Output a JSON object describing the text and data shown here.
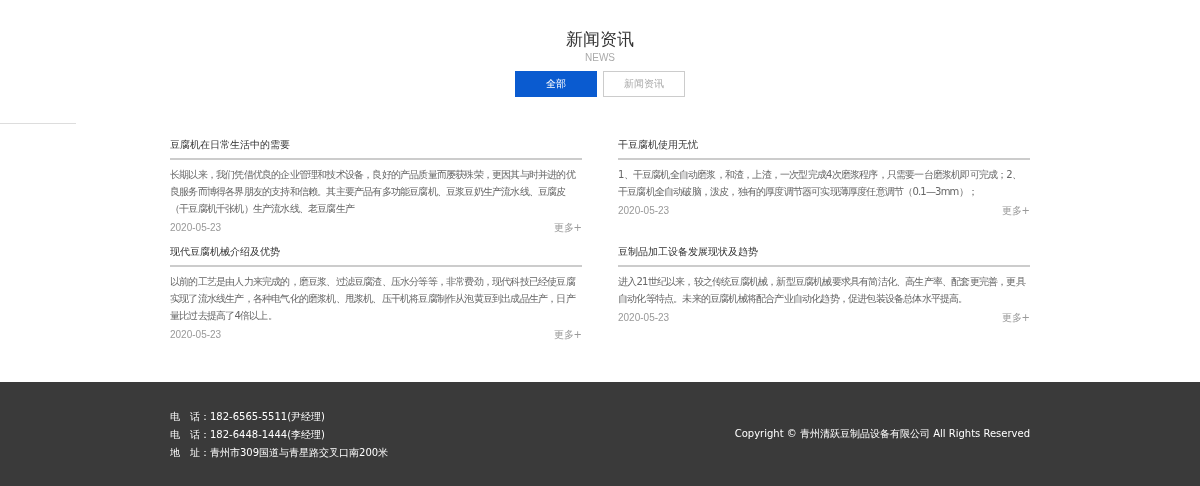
{
  "header": {
    "title": "新闻资讯",
    "subtitle": "NEWS"
  },
  "tabs": [
    {
      "label": "全部",
      "selected": true
    },
    {
      "label": "新闻资讯",
      "selected": false
    }
  ],
  "news": [
    {
      "title": "豆腐机在日常生活中的需要",
      "summary": "长期以来，我们凭借优良的企业管理和技术设备，良好的产品质量而屡获殊荣，更因其与时并进的优良服务而博得各界朋友的支持和信赖。其主要产品有多功能豆腐机、豆浆豆奶生产流水线、豆腐皮（干豆腐机千张机）生产流水线、老豆腐生产",
      "date": "2020-05-23",
      "more": "更多+"
    },
    {
      "title": "干豆腐机使用无忧",
      "summary": "1、干豆腐机全自动磨浆，和渣，上渣，一次型完成4次磨浆程序，只需要一台磨浆机即可完成；2、干豆腐机全自动破脑，泼皮，独有的厚度调节器可实现薄厚度任意调节（0.1—3mm）；",
      "date": "2020-05-23",
      "more": "更多+"
    },
    {
      "title": "现代豆腐机械介绍及优势",
      "summary": "以前的工艺是由人力来完成的，磨豆浆、过滤豆腐渣、压水分等等，非常费劲，现代科技已经使豆腐实现了流水线生产，各种电气化的磨浆机、甩浆机、压干机将豆腐制作从泡黄豆到出成品生产，日产量比过去提高了4倍以上。",
      "date": "2020-05-23",
      "more": "更多+"
    },
    {
      "title": "豆制品加工设备发展现状及趋势",
      "summary": "进入21世纪以来，较之传统豆腐机械，新型豆腐机械要求具有简洁化、高生产率、配套更完善，更具自动化等特点。未来的豆腐机械将配合产业自动化趋势，促进包装设备总体水平提高。",
      "date": "2020-05-23",
      "more": "更多+"
    }
  ],
  "footer": {
    "contacts": [
      {
        "label": "电　话：",
        "value": "182-6565-5511(尹经理)"
      },
      {
        "label": "电　话：",
        "value": "182-6448-1444(李经理)"
      },
      {
        "label": "地　址：",
        "value": "青州市309国道与青星路交叉口南200米"
      }
    ],
    "copyright": "Copyright © 青州清跃豆制品设备有限公司 All Rights Reserved"
  }
}
